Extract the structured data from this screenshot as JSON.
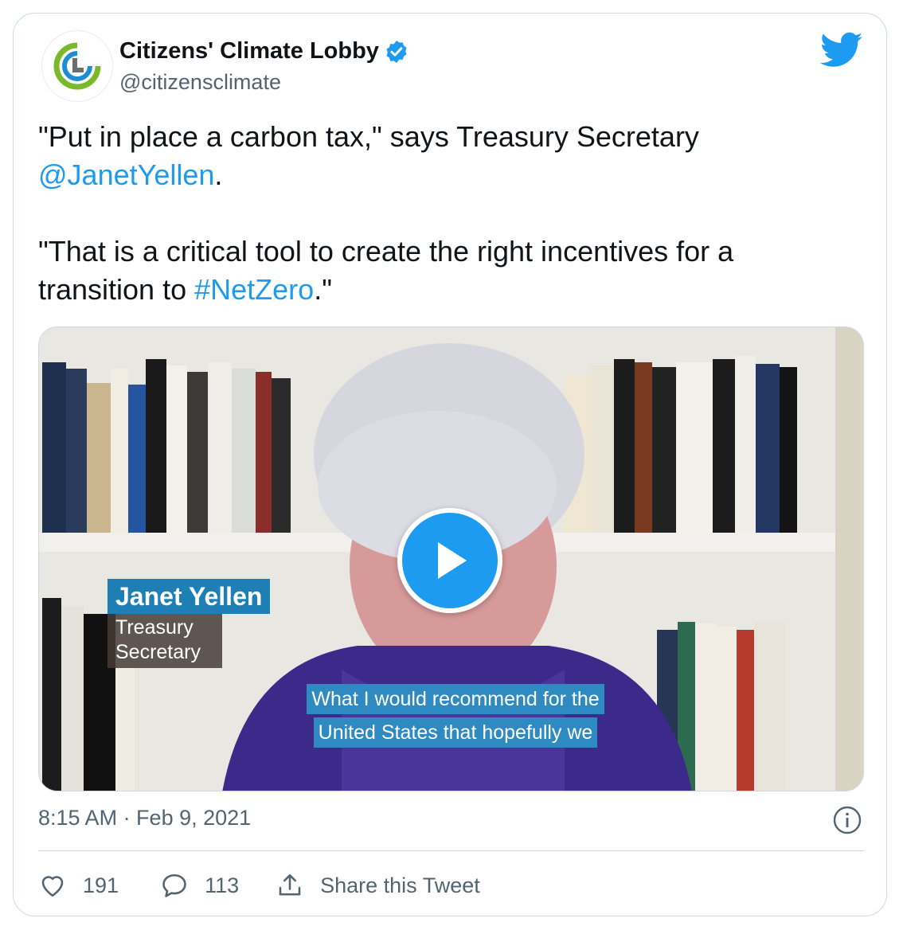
{
  "author": {
    "display_name": "Citizens' Climate Lobby",
    "handle": "@citizensclimate",
    "verified": true,
    "avatar_icon": "citizens-climate-lobby-logo",
    "brand_colors": {
      "green": "#7ab929",
      "blue": "#1d8fd1",
      "gray": "#6d6e71"
    }
  },
  "tweet": {
    "p1_before": "\"Put in place a carbon tax,\" says Treasury Secretary ",
    "p1_mention": "@JanetYellen",
    "p1_after": ".",
    "p2_before": "\"That is a critical tool to create the right incentives for a transition to ",
    "p2_hashtag": "#NetZero",
    "p2_after": ".\""
  },
  "video": {
    "lower_third_name": "Janet Yellen",
    "lower_third_title": "Treasury Secretary",
    "caption_line1": "What I would recommend for the",
    "caption_line2": "United States that hopefully we",
    "play_icon": "play-icon"
  },
  "meta": {
    "timestamp": "8:15 AM · Feb 9, 2021"
  },
  "actions": {
    "like_count": "191",
    "reply_count": "113",
    "share_label": "Share this Tweet"
  },
  "colors": {
    "link": "#1d9bf0",
    "text": "#0f1419",
    "secondary": "#536471",
    "border": "#cfd9de"
  }
}
